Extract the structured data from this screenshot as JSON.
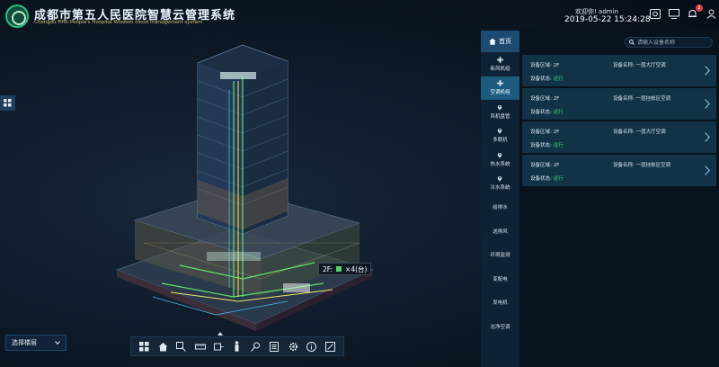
{
  "header": {
    "title": "成都市第五人民医院智慧云管理系统",
    "subtitle": "Chengdu Fifth People's Hospital Wisdom cloud management system",
    "welcome": "欢迎你! admin",
    "datetime": "2019-05-22 15:24:28",
    "notification_count": "2"
  },
  "floor_select": {
    "value": "选择楼层"
  },
  "model_tooltip": {
    "floor": "2F:",
    "count": "×4(台)"
  },
  "nav": {
    "home_label": "首页",
    "items": [
      {
        "label": "新风机组",
        "icon": "fan-icon"
      },
      {
        "label": "空调机组",
        "icon": "fan-icon",
        "active": true
      },
      {
        "label": "风机盘管",
        "icon": "location-pin-icon"
      },
      {
        "label": "多联机",
        "icon": "location-pin-icon"
      },
      {
        "label": "热水系统",
        "icon": "location-pin-icon"
      },
      {
        "label": "冷水系统",
        "icon": "location-pin-icon"
      },
      {
        "label": "给排水"
      },
      {
        "label": "送排风"
      },
      {
        "label": "环境监测"
      },
      {
        "label": "变配电"
      },
      {
        "label": "发电机"
      },
      {
        "label": "洁净空调"
      }
    ]
  },
  "search": {
    "placeholder": "请输入设备名称"
  },
  "devices": [
    {
      "area": "设备区域: 2F",
      "name": "设备名称: 一层大厅空调",
      "status_label": "设备状态:",
      "status": "运行"
    },
    {
      "area": "设备区域: 2F",
      "name": "设备名称: 一层挂帐区空调",
      "status_label": "设备状态:",
      "status": "运行"
    },
    {
      "area": "设备区域: 2F",
      "name": "设备名称: 一层大厅空调",
      "status_label": "设备状态:",
      "status": "运行"
    },
    {
      "area": "设备区域: 2F",
      "name": "设备名称: 一层挂帐区空调",
      "status_label": "设备状态:",
      "status": "运行"
    }
  ],
  "colors": {
    "accent": "#1d4a70",
    "active_nav": "#1a5b7e",
    "card": "#123247",
    "status_green": "#3ddc7b"
  }
}
